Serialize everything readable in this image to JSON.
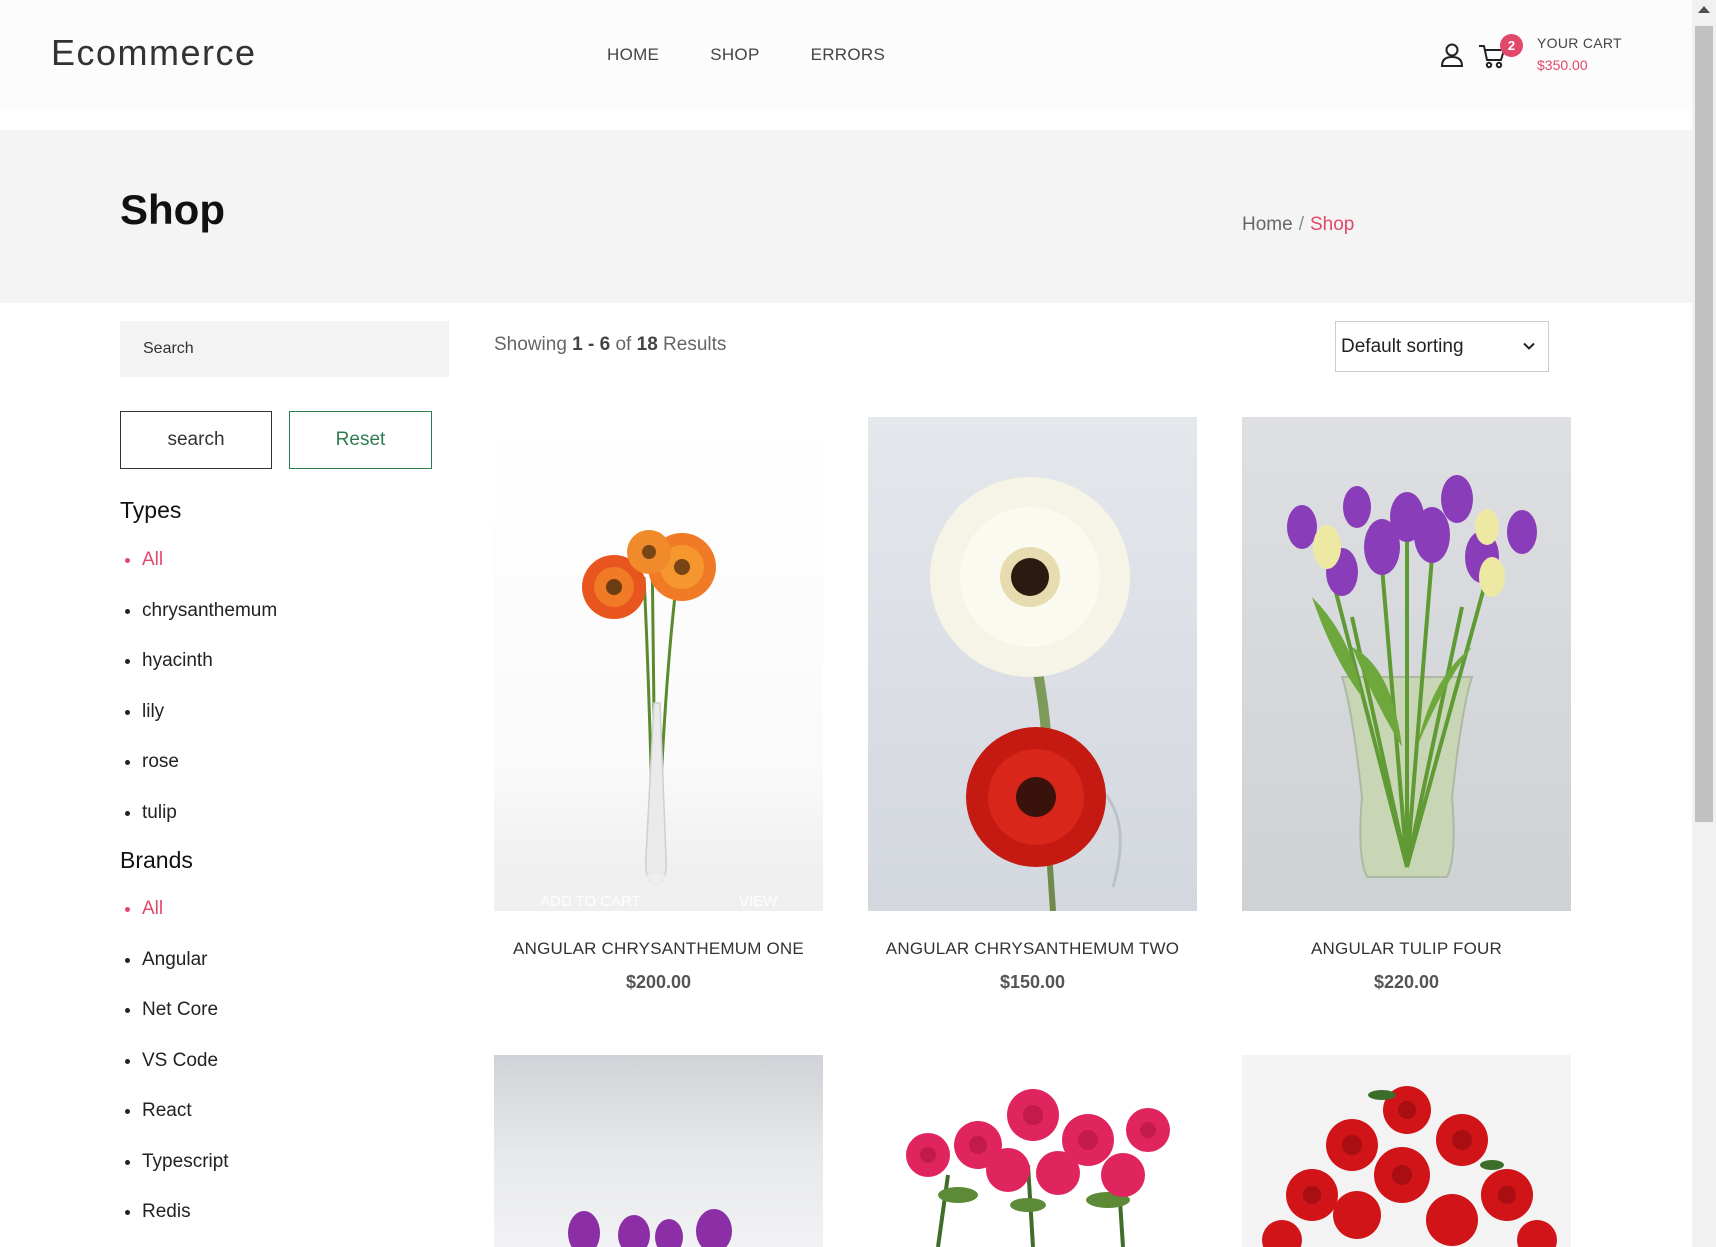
{
  "header": {
    "logo": "Ecommerce",
    "nav": [
      "HOME",
      "SHOP",
      "ERRORS"
    ],
    "cart_badge": "2",
    "cart_label": "YOUR CART",
    "cart_amount": "$350.00"
  },
  "banner": {
    "title": "Shop",
    "breadcrumb_home": "Home",
    "breadcrumb_separator": "/",
    "breadcrumb_current": "Shop"
  },
  "sidebar": {
    "search_placeholder": "Search",
    "search_button": "search",
    "reset_button": "Reset",
    "types_title": "Types",
    "types": [
      "All",
      "chrysanthemum",
      "hyacinth",
      "lily",
      "rose",
      "tulip"
    ],
    "brands_title": "Brands",
    "brands": [
      "All",
      "Angular",
      "Net Core",
      "VS Code",
      "React",
      "Typescript",
      "Redis"
    ]
  },
  "results": {
    "prefix": "Showing",
    "range": "1 - 6",
    "of": "of",
    "total": "18",
    "suffix": "Results",
    "sort": "Default sorting"
  },
  "products": [
    {
      "name": "ANGULAR CHRYSANTHEMUM ONE",
      "price": "$200.00",
      "overlay_add": "ADD TO CART",
      "overlay_view": "VIEW"
    },
    {
      "name": "ANGULAR CHRYSANTHEMUM TWO",
      "price": "$150.00"
    },
    {
      "name": "ANGULAR TULIP FOUR",
      "price": "$220.00"
    }
  ],
  "colors": {
    "accent": "#e2486b",
    "reset_green": "#2e7d52",
    "banner_bg": "#f4f4f4"
  },
  "icons": [
    "user-icon",
    "cart-icon",
    "chevron-down-icon"
  ]
}
